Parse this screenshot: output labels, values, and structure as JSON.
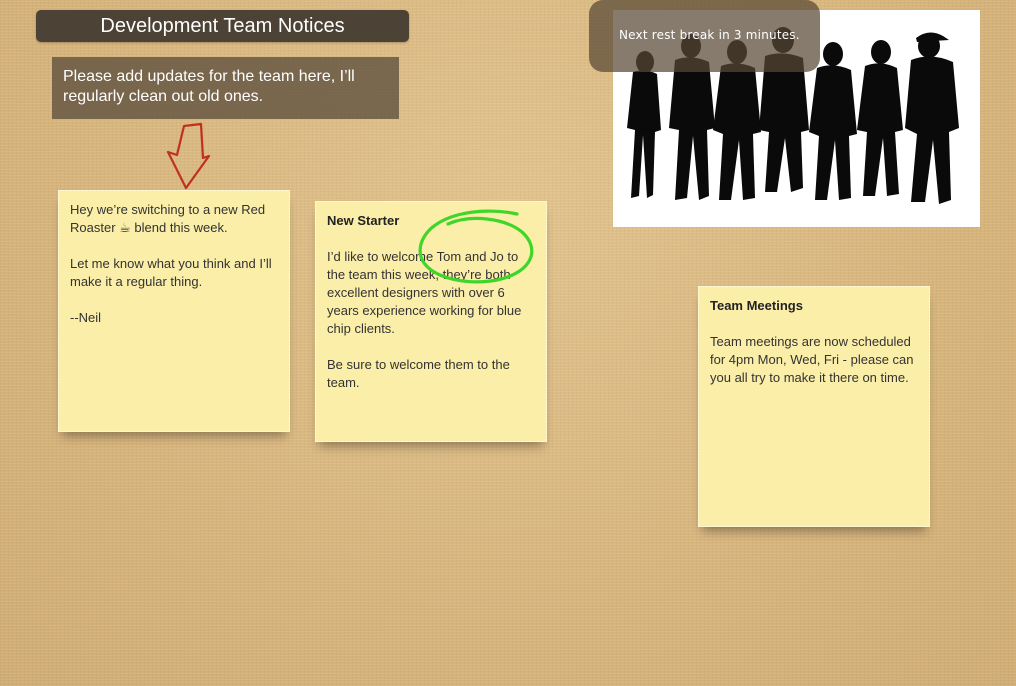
{
  "board": {
    "title": "Development Team Notices",
    "intro": "Please add updates for the team here, I’ll regularly clean out old ones."
  },
  "notes": [
    {
      "heading": "",
      "paragraphs": [
        "Hey we’re switching to a new Red Roaster ☕ blend this week.",
        "Let me know what you think and I’ll make it a regular thing.",
        "--Neil"
      ]
    },
    {
      "heading": "New Starter",
      "paragraphs": [
        "I’d like to welcome Tom and Jo to the team this week, they’re both excellent designers with over 6 years experience working for blue chip clients.",
        "Be sure to welcome them to the team."
      ]
    },
    {
      "heading": "Team Meetings",
      "paragraphs": [
        "Team meetings are now scheduled for 4pm Mon, Wed, Fri - please can you all try to make it there on time."
      ]
    }
  ],
  "notification": {
    "text": "Next rest break in 3 minutes."
  },
  "annotations": {
    "arrow_color": "#c0301e",
    "circle_color": "#3fd62a"
  }
}
